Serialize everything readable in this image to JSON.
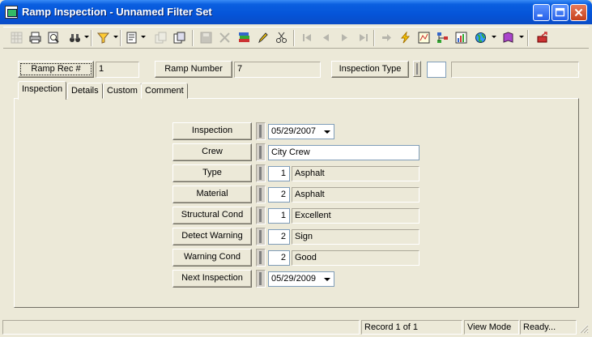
{
  "window": {
    "title": "Ramp Inspection - Unnamed Filter Set"
  },
  "header": {
    "ramp_rec_label": "Ramp Rec #",
    "ramp_rec_value": "1",
    "ramp_number_label": "Ramp Number",
    "ramp_number_value": "7",
    "inspection_type_label": "Inspection Type",
    "inspection_type_code": "",
    "inspection_type_desc": ""
  },
  "tabs": [
    {
      "label": "Inspection",
      "active": true
    },
    {
      "label": "Details",
      "active": false
    },
    {
      "label": "Custom",
      "active": false
    },
    {
      "label": "Comment",
      "active": false
    }
  ],
  "form": {
    "inspection": {
      "label": "Inspection",
      "value": "05/29/2007"
    },
    "crew": {
      "label": "Crew",
      "value": "City Crew"
    },
    "type": {
      "label": "Type",
      "code": "1",
      "desc": "Asphalt"
    },
    "material": {
      "label": "Material",
      "code": "2",
      "desc": "Asphalt"
    },
    "structural_cond": {
      "label": "Structural Cond",
      "code": "1",
      "desc": "Excellent"
    },
    "detect_warning": {
      "label": "Detect Warning",
      "code": "2",
      "desc": "Sign"
    },
    "warning_cond": {
      "label": "Warning Cond",
      "code": "2",
      "desc": "Good"
    },
    "next_inspection": {
      "label": "Next Inspection",
      "value": "05/29/2009"
    }
  },
  "statusbar": {
    "blank": "",
    "record": "Record 1 of 1",
    "mode": "View Mode",
    "state": "Ready..."
  },
  "toolbar_icons": [
    "grid-icon",
    "print-icon",
    "print-preview-icon",
    "binoculars-icon",
    "filter-icon",
    "report-icon",
    "copy-record-icon",
    "paste-record-icon",
    "save-icon",
    "delete-icon",
    "books-icon",
    "pencil-icon",
    "scissors-icon",
    "first-record-icon",
    "previous-record-icon",
    "next-record-icon",
    "last-record-icon",
    "goto-icon",
    "lightning-icon",
    "map-icon",
    "hierarchy-icon",
    "chart-icon",
    "globe-icon",
    "book-icon",
    "exit-icon"
  ],
  "colors": {
    "titlebar": "#0554d8",
    "chrome": "#ece9d8",
    "input_border": "#7f9db9"
  }
}
